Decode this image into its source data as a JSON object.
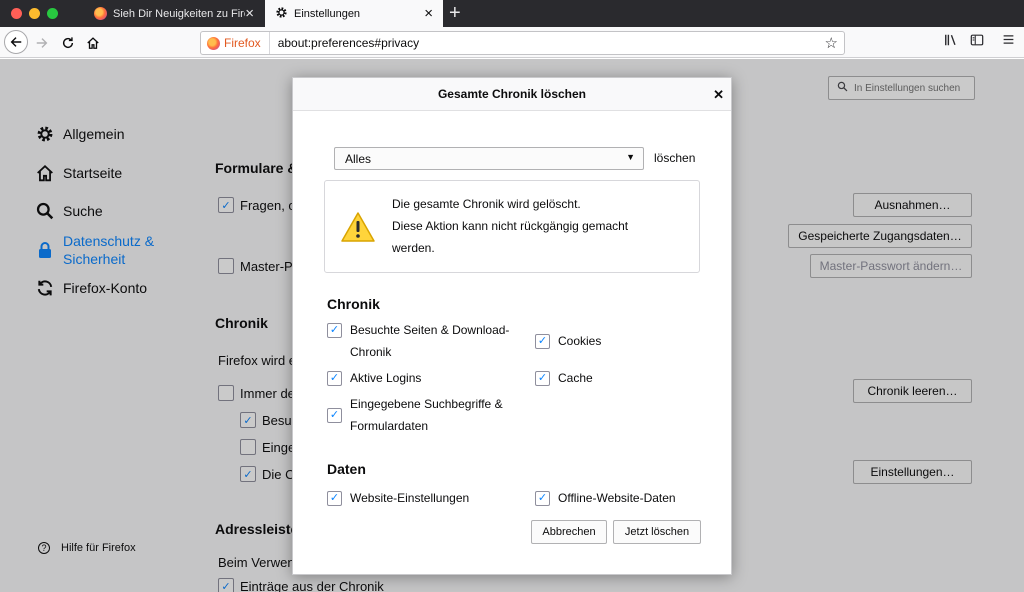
{
  "colors": {
    "tabstrip": "#2a2a2e",
    "accent": "#0a84ff",
    "close_light": "#ff5f57",
    "minimize_light": "#febc2e",
    "zoom_light": "#28c840"
  },
  "tabs": [
    {
      "title": "Sieh Dir Neuigkeiten zu Firefox",
      "icon": "firefox-icon"
    },
    {
      "title": "Einstellungen",
      "icon": "gear-icon"
    }
  ],
  "toolbar": {
    "identity_label": "Firefox",
    "url": "about:preferences#privacy"
  },
  "prefs": {
    "search_placeholder": "In Einstellungen suchen",
    "categories": [
      {
        "label": "Allgemein",
        "icon": "gear-icon"
      },
      {
        "label": "Startseite",
        "icon": "home-icon"
      },
      {
        "label": "Suche",
        "icon": "search-icon"
      },
      {
        "label": "Datenschutz &",
        "label2": "Sicherheit",
        "icon": "lock-icon",
        "selected": true
      },
      {
        "label": "Firefox-Konto",
        "icon": "sync-icon"
      }
    ],
    "help_label": "Hilfe für Firefox",
    "sections": {
      "forms_heading": "Formulare &",
      "forms_ask": "Fragen, o",
      "forms_master": "Master-Pa",
      "history_heading": "Chronik",
      "history_intro": "Firefox wird e",
      "history_always": "Immer de",
      "history_visited": "Besuc",
      "history_entered": "Einge",
      "history_cookies": "Die C",
      "addressbar_heading": "Adressleiste",
      "addressbar_intro": "Beim Verwenc",
      "addressbar_history": "Einträge aus der Chronik"
    },
    "buttons": {
      "exceptions": "Ausnahmen…",
      "saved_logins": "Gespeicherte Zugangsdaten…",
      "change_master": "Master-Passwort ändern…",
      "clear_history": "Chronik leeren…",
      "settings": "Einstellungen…"
    }
  },
  "dialog": {
    "title": "Gesamte Chronik löschen",
    "range_value": "Alles",
    "range_suffix": "löschen",
    "warning_line1": "Die gesamte Chronik wird gelöscht.",
    "warning_line2": "Diese Aktion kann nicht rückgängig gemacht",
    "warning_line3": "werden.",
    "history_heading": "Chronik",
    "history_items": [
      {
        "label": "Besuchte Seiten & Download-",
        "label2": "Chronik",
        "checked": true
      },
      {
        "label": "Cookies",
        "checked": true
      },
      {
        "label": "Aktive Logins",
        "checked": true
      },
      {
        "label": "Cache",
        "checked": true
      },
      {
        "label": "Eingegebene Suchbegriffe &",
        "label2": "Formulardaten",
        "checked": true
      }
    ],
    "data_heading": "Daten",
    "data_items": [
      {
        "label": "Website-Einstellungen",
        "checked": true
      },
      {
        "label": "Offline-Website-Daten",
        "checked": true
      }
    ],
    "cancel_label": "Abbrechen",
    "accept_label": "Jetzt löschen"
  }
}
